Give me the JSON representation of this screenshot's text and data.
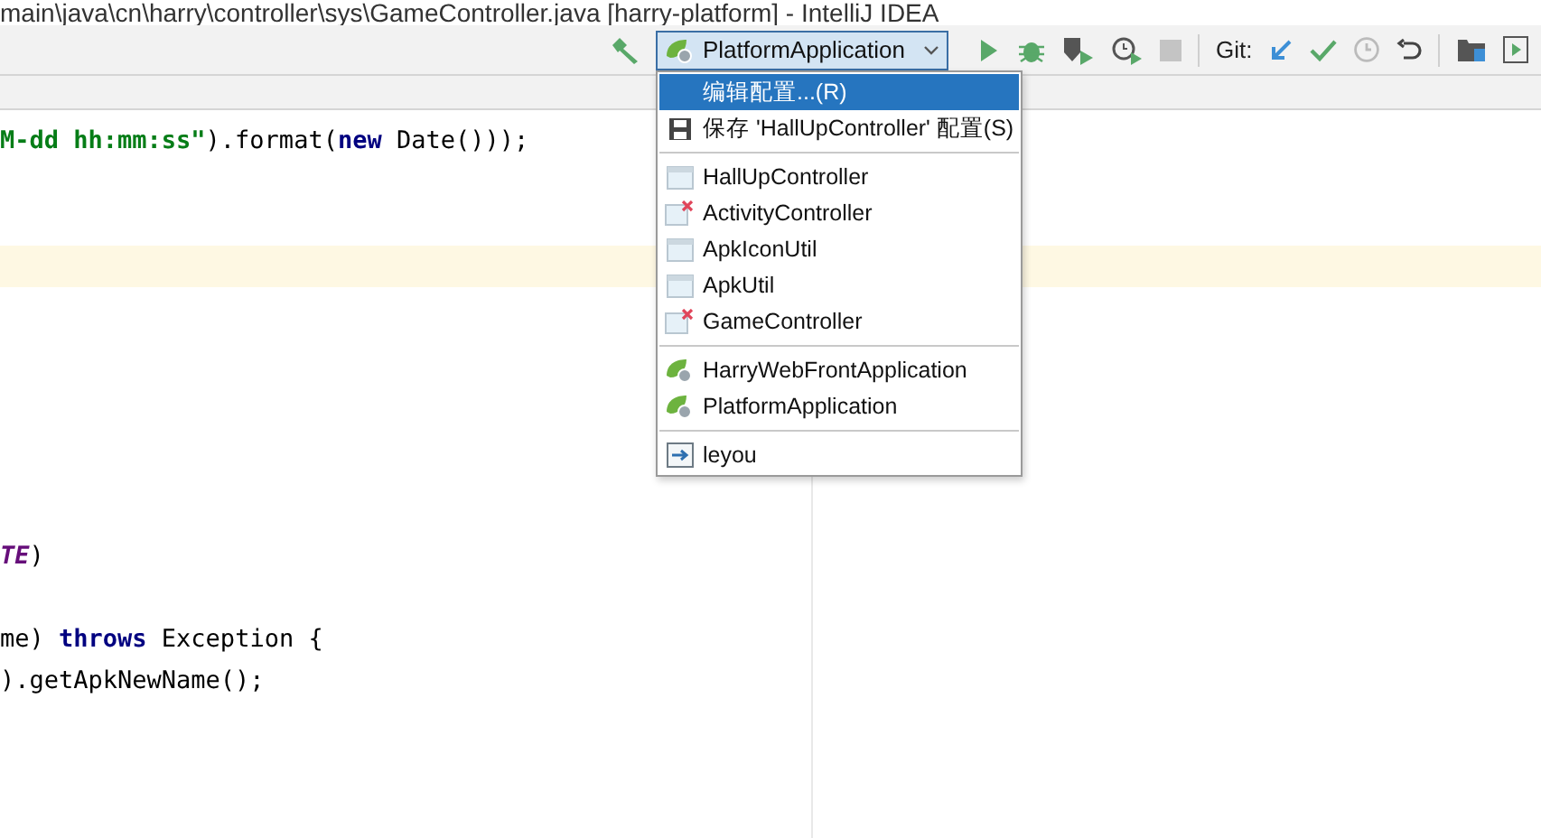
{
  "window": {
    "title": "main\\java\\cn\\harry\\controller\\sys\\GameController.java [harry-platform] - IntelliJ IDEA"
  },
  "toolbar": {
    "run_configuration": {
      "label": "PlatformApplication"
    },
    "git_label": "Git:"
  },
  "editor": {
    "lines": [
      {
        "kind": "code",
        "highlighted": false,
        "segments": [
          {
            "kind": "string",
            "text": "M-dd hh:mm:ss\""
          },
          {
            "kind": "plain",
            "text": ").format("
          },
          {
            "kind": "keyword",
            "text": "new"
          },
          {
            "kind": "plain",
            "text": " Date()));"
          }
        ]
      },
      {
        "kind": "blank",
        "highlighted": false
      },
      {
        "kind": "blank",
        "highlighted": false
      },
      {
        "kind": "blank",
        "highlighted": true
      },
      {
        "kind": "blank",
        "highlighted": false
      },
      {
        "kind": "blank",
        "highlighted": false
      },
      {
        "kind": "blank",
        "highlighted": false
      },
      {
        "kind": "blank",
        "highlighted": false
      },
      {
        "kind": "blank",
        "highlighted": false
      },
      {
        "kind": "blank",
        "highlighted": false
      },
      {
        "kind": "code",
        "highlighted": false,
        "segments": [
          {
            "kind": "constant",
            "text": "TE"
          },
          {
            "kind": "plain",
            "text": ")"
          }
        ]
      },
      {
        "kind": "blank",
        "highlighted": false
      },
      {
        "kind": "code",
        "highlighted": false,
        "segments": [
          {
            "kind": "plain",
            "text": "me) "
          },
          {
            "kind": "keyword",
            "text": "throws"
          },
          {
            "kind": "plain",
            "text": " Exception {"
          }
        ]
      },
      {
        "kind": "code",
        "highlighted": false,
        "segments": [
          {
            "kind": "plain",
            "text": ").getApkNewName();"
          }
        ]
      }
    ]
  },
  "dropdown": {
    "items": [
      {
        "kind": "plain",
        "label": "编辑配置...(R)",
        "selected": true
      },
      {
        "kind": "save",
        "label": "保存 'HallUpController' 配置(S)",
        "selected": false
      },
      {
        "kind": "separator"
      },
      {
        "kind": "test",
        "label": "HallUpController",
        "selected": false
      },
      {
        "kind": "test-error",
        "label": "ActivityController",
        "selected": false
      },
      {
        "kind": "test",
        "label": "ApkIconUtil",
        "selected": false
      },
      {
        "kind": "test",
        "label": "ApkUtil",
        "selected": false
      },
      {
        "kind": "test-error",
        "label": "GameController",
        "selected": false
      },
      {
        "kind": "separator"
      },
      {
        "kind": "spring",
        "label": "HarryWebFrontApplication",
        "selected": false
      },
      {
        "kind": "spring",
        "label": "PlatformApplication",
        "selected": false
      },
      {
        "kind": "separator"
      },
      {
        "kind": "compound",
        "label": "leyou",
        "selected": false
      }
    ]
  }
}
